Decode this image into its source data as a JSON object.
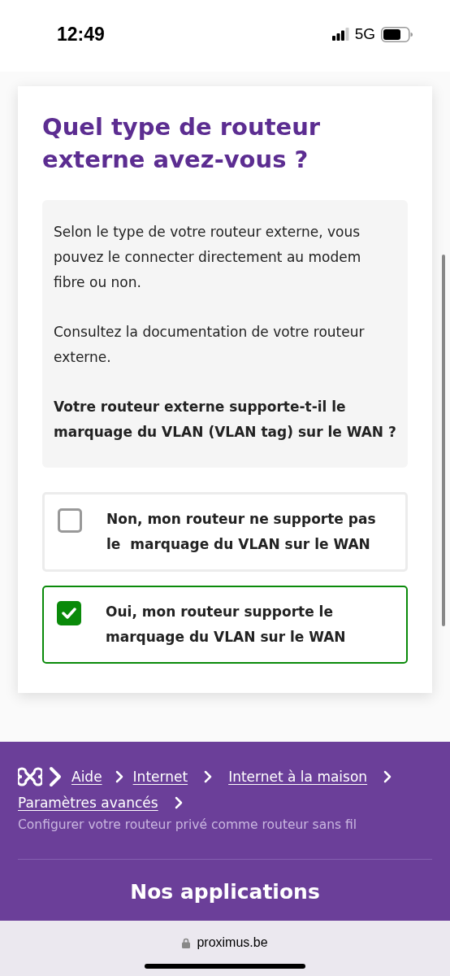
{
  "status_bar": {
    "time": "12:49",
    "network": "5G"
  },
  "card": {
    "title": "Quel type de routeur externe avez-vous ?",
    "info": [
      {
        "kind": "text",
        "text": "Selon le type de votre routeur externe, vous pouvez le connecter directement au modem fibre ou non."
      },
      {
        "kind": "text",
        "text": "Consultez la documentation de votre routeur externe."
      },
      {
        "kind": "question",
        "text": "Votre routeur externe supporte-t-il le marquage du VLAN (VLAN tag) sur le WAN ?"
      }
    ],
    "options": [
      {
        "label": "Non, mon routeur ne supporte pas le  marquage du VLAN sur le WAN",
        "checked": false
      },
      {
        "label": "Oui, mon routeur supporte le  marquage du VLAN sur le WAN",
        "checked": true
      }
    ]
  },
  "footer": {
    "breadcrumb": [
      "Aide",
      "Internet",
      "Internet à la maison",
      "Paramètres avancés"
    ],
    "current_page": "Configurer votre routeur privé comme routeur sans fil",
    "heading": "Nos applications"
  },
  "browser": {
    "url": "proximus.be"
  }
}
